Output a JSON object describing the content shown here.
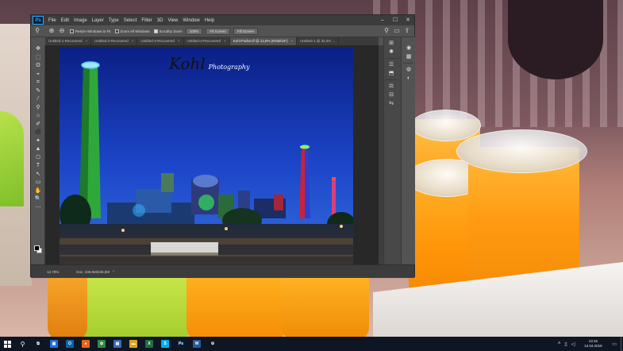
{
  "app": {
    "logo": "Ps",
    "menu": [
      "File",
      "Edit",
      "Image",
      "Layer",
      "Type",
      "Select",
      "Filter",
      "3D",
      "View",
      "Window",
      "Help"
    ],
    "window_controls": {
      "minimize": "–",
      "maximize": "☐",
      "close": "✕"
    }
  },
  "options_bar": {
    "zoom_icon": "zoom-icon",
    "resize_label": "Resize Windows to Fit",
    "zoom_all_label": "Zoom All Windows",
    "scrubby_label": "Scrubby Zoom",
    "resize_checked": false,
    "zoom_all_checked": false,
    "scrubby_checked": true,
    "zoom_100": "100%",
    "fit_screen": "Fit Screen",
    "fill_screen": "Fill Screen"
  },
  "tabs": [
    {
      "label": "Untitled-1-Recovered",
      "active": false
    },
    {
      "label": "Untitled-2-Recovered",
      "active": false
    },
    {
      "label": "Untitled-3-Recovered",
      "active": false
    },
    {
      "label": "Untitled-4-Recovered",
      "active": false
    },
    {
      "label": "Kohl-Farbe.tif @ 12,8% (RGB/16*)",
      "active": true
    },
    {
      "label": "Untitled-1 @ 33,3% ...",
      "active": false
    }
  ],
  "tab_close": "×",
  "tools": [
    "✥",
    "⬚",
    "ʘ",
    "⌖",
    "⌗",
    "✎",
    "⁄",
    "⚲",
    "⌂",
    "✐",
    "⬛",
    "✦",
    "▲",
    "⎔",
    "T",
    "↖",
    "▭",
    "✋",
    "🔍",
    "⋯"
  ],
  "panels_a": [
    "⊞",
    "✺",
    "☰",
    "⬒",
    "⚖",
    "⊟",
    "⇆"
  ],
  "panels_b": [
    "◉",
    "▦",
    "◍",
    "◐"
  ],
  "canvas_watermark": {
    "line1": "Kohl",
    "line2": "Photography"
  },
  "status": {
    "zoom": "12,78%",
    "doc": "Doc: 235,5M/235,5M",
    "arrow": "›"
  },
  "taskbar": {
    "start_icon": "windows-start-icon",
    "search_icon": "search-icon",
    "apps": [
      {
        "name": "task-view-icon",
        "label": "⧉",
        "color": "#0f1623"
      },
      {
        "name": "store-icon",
        "label": "▣",
        "color": "#1e6fd9"
      },
      {
        "name": "outlook-icon",
        "label": "O",
        "color": "#0a64ad"
      },
      {
        "name": "firefox-icon",
        "label": "●",
        "color": "#e8621d"
      },
      {
        "name": "paint-icon",
        "label": "✿",
        "color": "#2e8b3e"
      },
      {
        "name": "save-icon",
        "label": "▤",
        "color": "#3a6ab5"
      },
      {
        "name": "explorer-icon",
        "label": "▬",
        "color": "#d9a520"
      },
      {
        "name": "excel-icon",
        "label": "X",
        "color": "#1d7044"
      },
      {
        "name": "skype-icon",
        "label": "S",
        "color": "#00aff0"
      },
      {
        "name": "photoshop-icon",
        "label": "Ps",
        "color": "#001e36"
      },
      {
        "name": "word-icon",
        "label": "W",
        "color": "#2b579a"
      },
      {
        "name": "settings-icon",
        "label": "⚙",
        "color": "#0f1623"
      }
    ],
    "time": "13:15",
    "date": "12.04.2018"
  }
}
